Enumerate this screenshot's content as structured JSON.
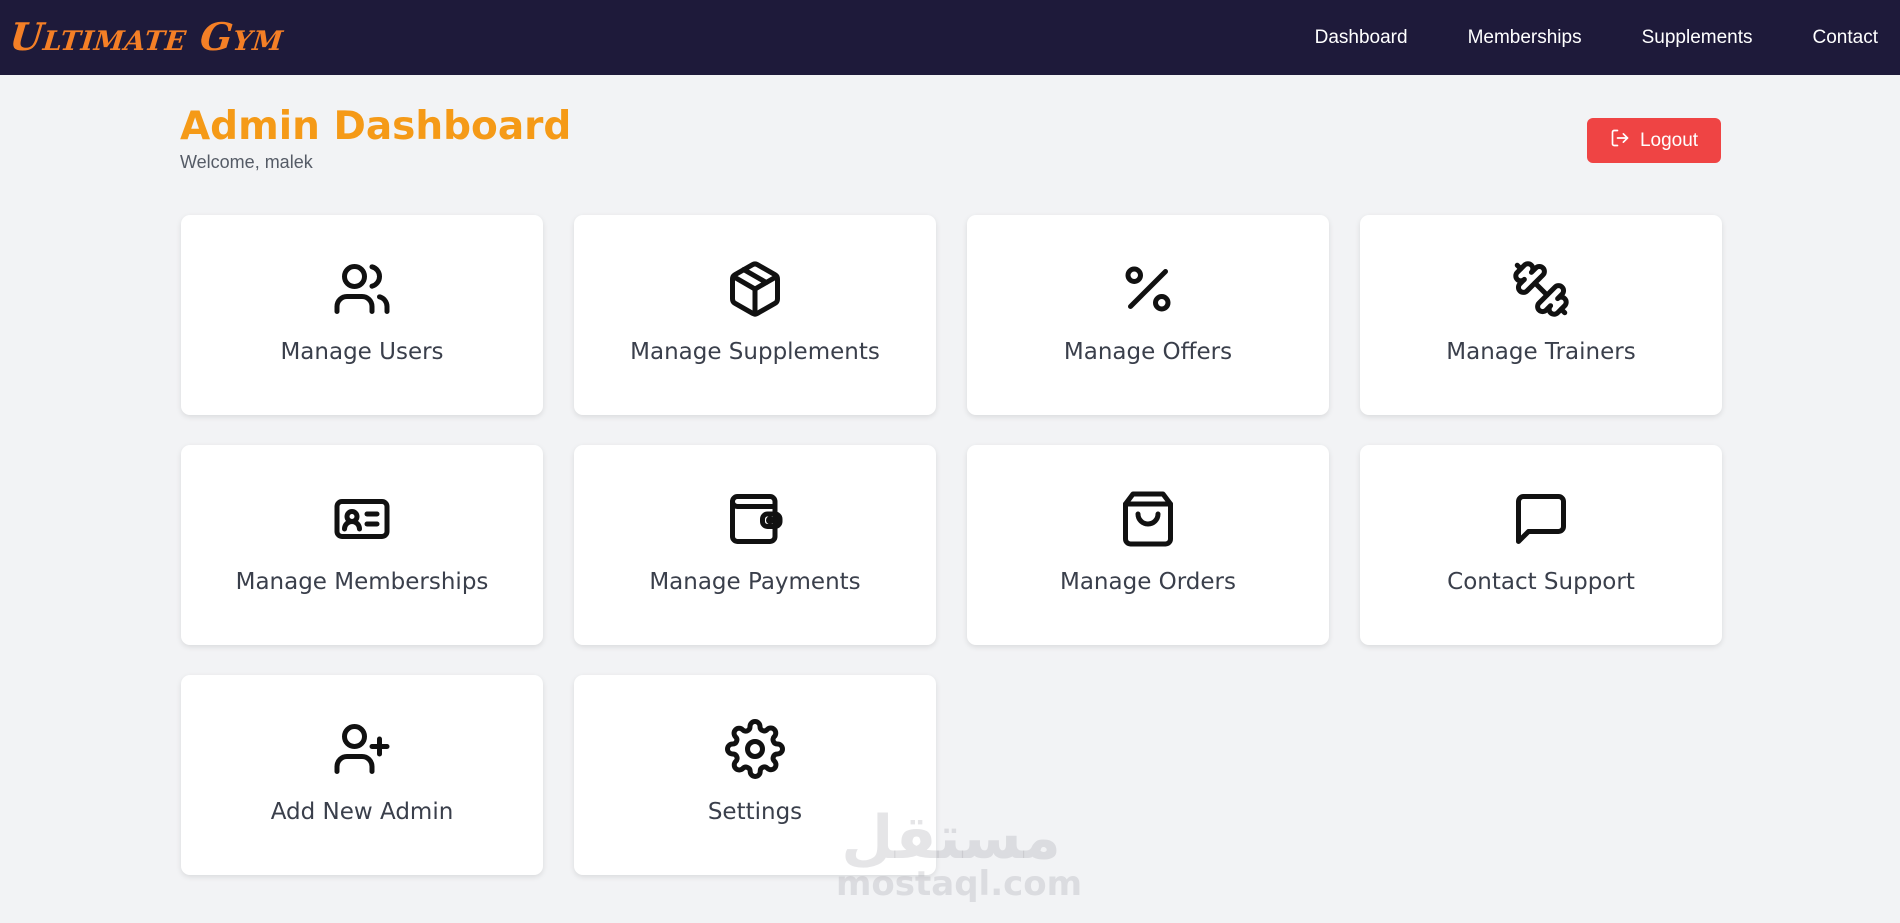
{
  "brand": {
    "name": "Ultimate Gym",
    "color": "#f47f26"
  },
  "nav": {
    "links": [
      "Dashboard",
      "Memberships",
      "Supplements",
      "Contact"
    ],
    "background": "#1e1a3a"
  },
  "header": {
    "title": "Admin Dashboard",
    "welcome": "Welcome, malek",
    "title_color": "#f59a17"
  },
  "logout": {
    "label": "Logout",
    "icon": "logout-icon",
    "color": "#ef4444"
  },
  "cards": [
    {
      "label": "Manage Users",
      "icon": "users-icon"
    },
    {
      "label": "Manage Supplements",
      "icon": "package-icon"
    },
    {
      "label": "Manage Offers",
      "icon": "percent-icon"
    },
    {
      "label": "Manage Trainers",
      "icon": "dumbbell-icon"
    },
    {
      "label": "Manage Memberships",
      "icon": "id-card-icon"
    },
    {
      "label": "Manage Payments",
      "icon": "wallet-icon"
    },
    {
      "label": "Manage Orders",
      "icon": "shopping-bag-icon"
    },
    {
      "label": "Contact Support",
      "icon": "message-icon"
    },
    {
      "label": "Add New Admin",
      "icon": "user-plus-icon"
    },
    {
      "label": "Settings",
      "icon": "settings-icon"
    }
  ],
  "watermark": {
    "arabic": "مستقل",
    "latin": "mostaql.com"
  }
}
